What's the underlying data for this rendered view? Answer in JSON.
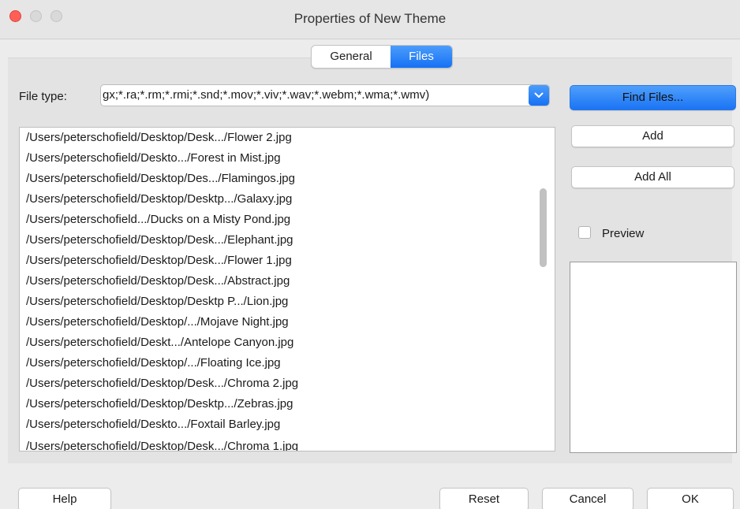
{
  "window": {
    "title": "Properties of New Theme"
  },
  "tabs": [
    {
      "label": "General",
      "selected": false
    },
    {
      "label": "Files",
      "selected": true
    }
  ],
  "file_type": {
    "label": "File type:",
    "value": "gx;*.ra;*.rm;*.rmi;*.snd;*.mov;*.viv;*.wav;*.webm;*.wma;*.wmv)"
  },
  "buttons": {
    "find_files": "Find Files...",
    "add": "Add",
    "add_all": "Add All",
    "help": "Help",
    "reset": "Reset",
    "cancel": "Cancel",
    "ok": "OK"
  },
  "preview": {
    "label": "Preview",
    "checked": false
  },
  "files": [
    "/Users/peterschofield/Desktop/Desk.../Flower 2.jpg",
    "/Users/peterschofield/Deskto.../Forest in Mist.jpg",
    "/Users/peterschofield/Desktop/Des.../Flamingos.jpg",
    "/Users/peterschofield/Desktop/Desktp.../Galaxy.jpg",
    "/Users/peterschofield.../Ducks on a Misty Pond.jpg",
    "/Users/peterschofield/Desktop/Desk.../Elephant.jpg",
    "/Users/peterschofield/Desktop/Desk.../Flower 1.jpg",
    "/Users/peterschofield/Desktop/Desk.../Abstract.jpg",
    "/Users/peterschofield/Desktop/Desktp P.../Lion.jpg",
    "/Users/peterschofield/Desktop/.../Mojave Night.jpg",
    "/Users/peterschofield/Deskt.../Antelope Canyon.jpg",
    "/Users/peterschofield/Desktop/.../Floating Ice.jpg",
    "/Users/peterschofield/Desktop/Desk.../Chroma 2.jpg",
    "/Users/peterschofield/Desktop/Desktp.../Zebras.jpg",
    "/Users/peterschofield/Deskto.../Foxtail Barley.jpg",
    "/Users/peterschofield/Desktop/Desk.../Chroma 1.jpg"
  ],
  "colors": {
    "accent": "#1671f5",
    "close_button": "#ff5f57"
  }
}
